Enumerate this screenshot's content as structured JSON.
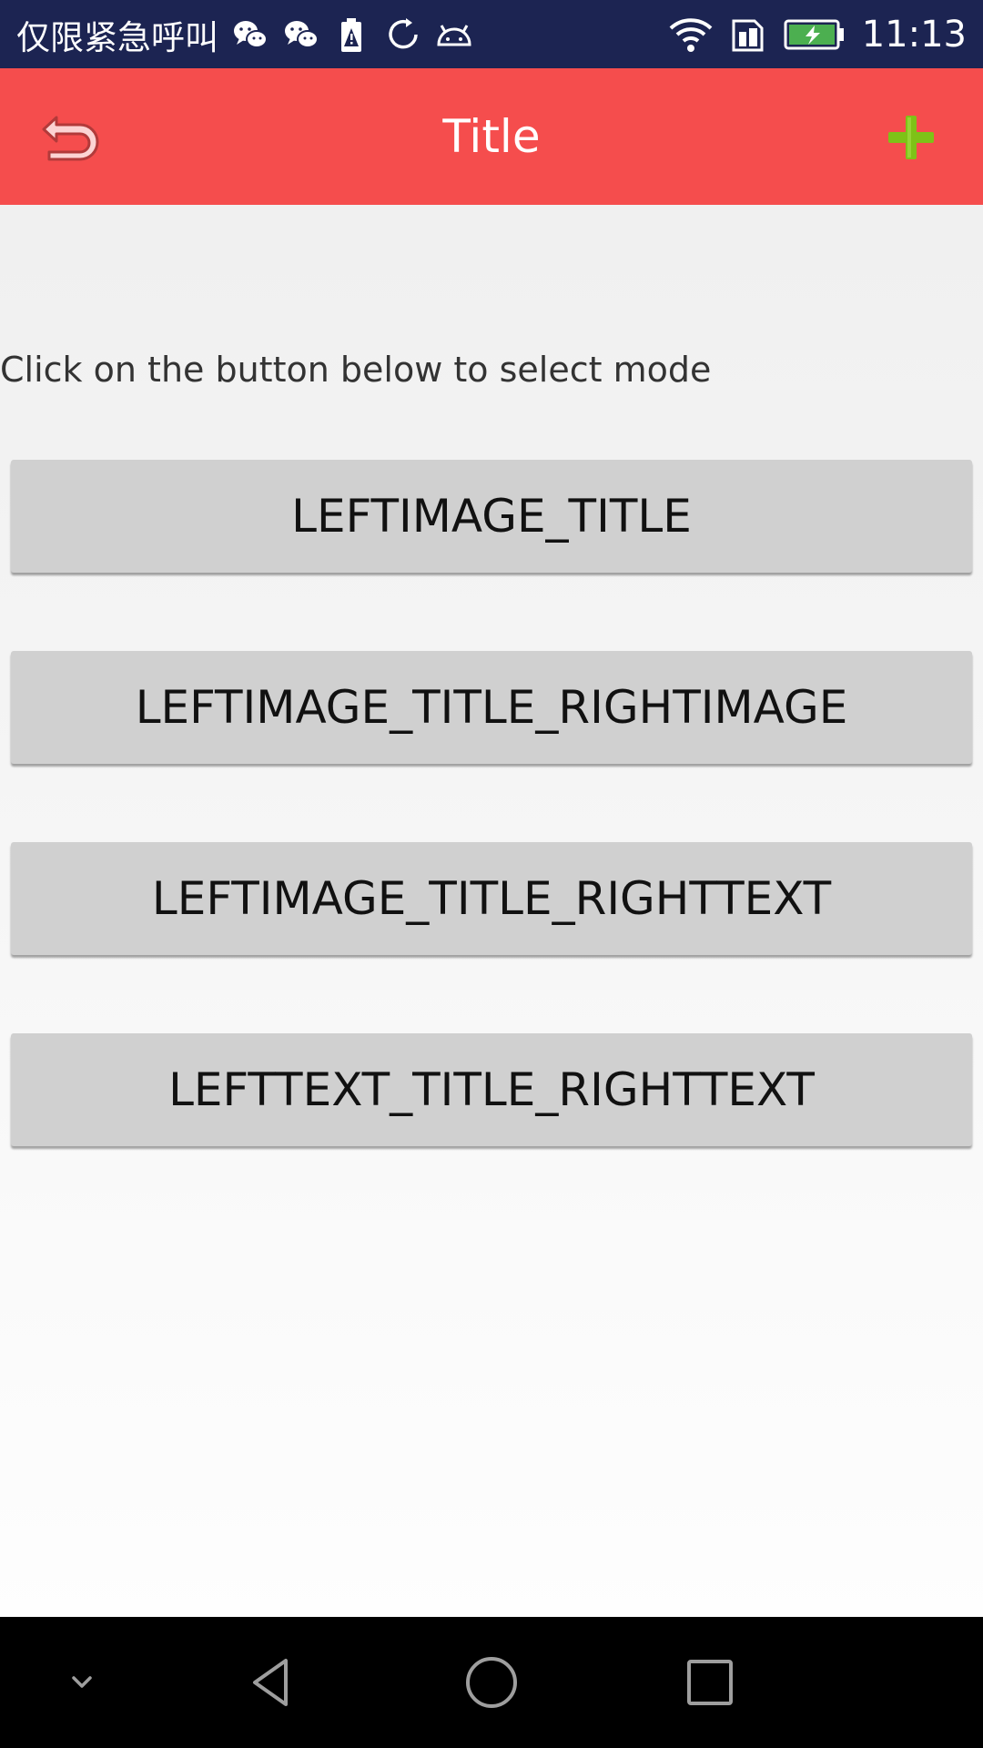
{
  "status_bar": {
    "carrier_text": "仅限紧急呼叫",
    "time": "11:13",
    "icons": [
      "wechat-icon",
      "wechat-icon",
      "battery-alert-icon",
      "sync-icon",
      "android-icon",
      "wifi-icon",
      "sim-icon",
      "battery-charging-icon"
    ]
  },
  "app_bar": {
    "title": "Title",
    "left_icon": "back-arrow-icon",
    "right_icon": "plus-icon",
    "background_color": "#f54d4d",
    "plus_color": "#7ec217"
  },
  "main": {
    "hint": "Click on the button below to select mode",
    "buttons": [
      {
        "label": "LEFTIMAGE_TITLE"
      },
      {
        "label": "LEFTIMAGE_TITLE_RIGHTIMAGE"
      },
      {
        "label": "LEFTIMAGE_TITLE_RIGHTTEXT"
      },
      {
        "label": "LEFTTEXT_TITLE_RIGHTTEXT"
      }
    ]
  },
  "nav_bar": {
    "icons": [
      "chevron-down-icon",
      "nav-back-icon",
      "nav-home-icon",
      "nav-recent-icon"
    ]
  }
}
